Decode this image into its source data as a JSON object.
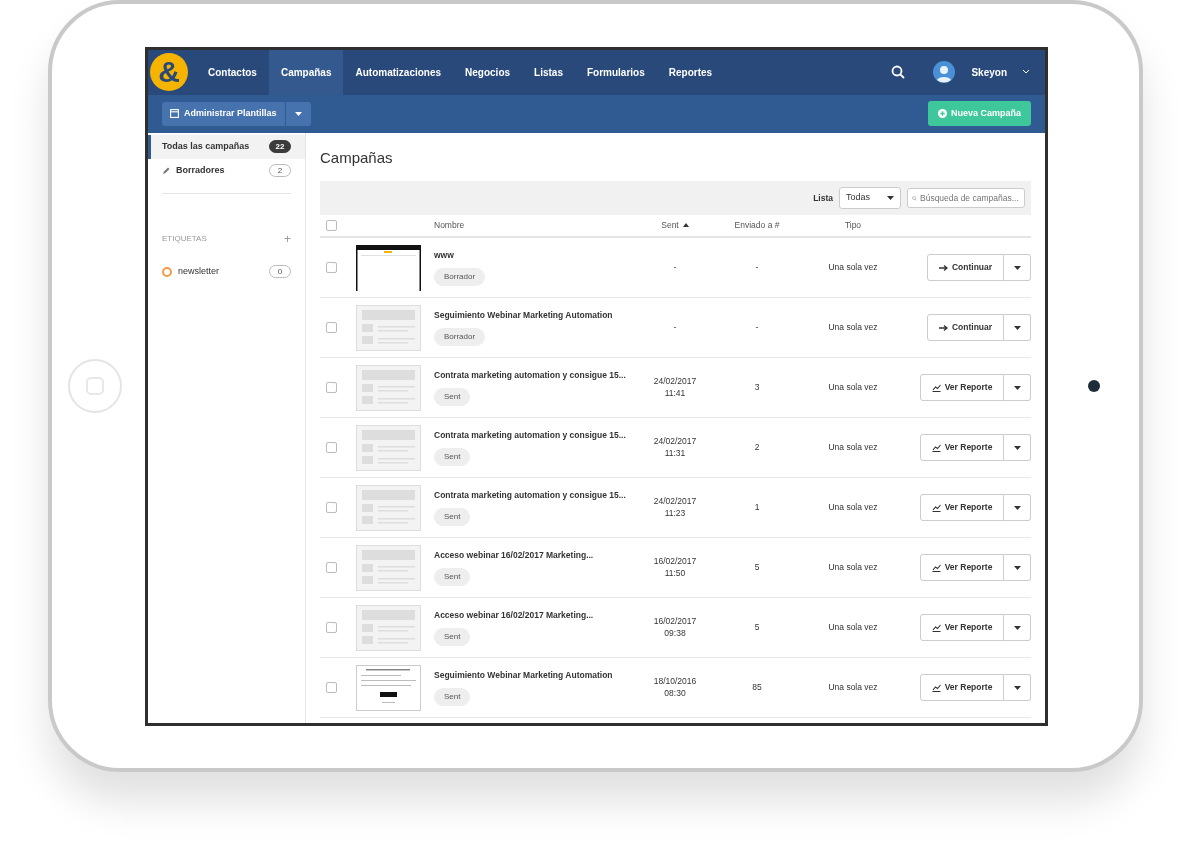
{
  "navbar": {
    "logo": "&",
    "tabs": [
      {
        "label": "Contactos",
        "selected": false
      },
      {
        "label": "Campañas",
        "selected": true
      },
      {
        "label": "Automatizaciones",
        "selected": false
      },
      {
        "label": "Negocios",
        "selected": false
      },
      {
        "label": "Listas",
        "selected": false
      },
      {
        "label": "Formularios",
        "selected": false
      },
      {
        "label": "Reportes",
        "selected": false
      }
    ],
    "user": "Skeyon"
  },
  "subbar": {
    "manage_button": "Administrar Plantillas",
    "new_button": "Nueva Campaña"
  },
  "sidebar": {
    "items": [
      {
        "label": "Todas las campañas",
        "count": "22",
        "selected": true,
        "kind": "all"
      },
      {
        "label": "Borradores",
        "count": "2",
        "selected": false,
        "kind": "drafts"
      }
    ],
    "tags_heading": "ETIQUETAS",
    "add": "+",
    "tags": [
      {
        "label": "newsletter",
        "count": "0",
        "color": "#f39a4a"
      }
    ]
  },
  "main": {
    "title": "Campañas",
    "filter_label": "Lista",
    "filter_value": "Todas",
    "search": {
      "placeholder": "Búsqueda de campañas..."
    },
    "select_all": {
      "checked": false
    },
    "columns": [
      {
        "label": "Nombre"
      },
      {
        "label": "Sent",
        "sort_ascending": true
      },
      {
        "label": "Enviado a #"
      },
      {
        "label": "Tipo"
      }
    ],
    "rows": [
      {
        "preview": {
          "kind": "screenshot"
        },
        "name": "www",
        "status": "Borrador",
        "sent": [],
        "recipients": "-",
        "sent_dash": "-",
        "type": "Una sola vez",
        "action": {
          "kind": "continue",
          "label": "Continuar"
        },
        "checked": false
      },
      {
        "preview": {
          "kind": "placeholder"
        },
        "name": "Seguimiento Webinar Marketing Automation",
        "status": "Borrador",
        "sent": [],
        "recipients": "-",
        "sent_dash": "-",
        "type": "Una sola vez",
        "action": {
          "kind": "continue",
          "label": "Continuar"
        },
        "checked": false
      },
      {
        "preview": {
          "kind": "placeholder"
        },
        "name": "Contrata marketing automation y consigue 15...",
        "status": "Sent",
        "sent": [
          "24/02/2017",
          "11:41"
        ],
        "recipients": "3",
        "type": "Una sola vez",
        "action": {
          "kind": "report",
          "label": "Ver Reporte"
        },
        "checked": false
      },
      {
        "preview": {
          "kind": "placeholder"
        },
        "name": "Contrata marketing automation y consigue 15...",
        "status": "Sent",
        "sent": [
          "24/02/2017",
          "11:31"
        ],
        "recipients": "2",
        "type": "Una sola vez",
        "action": {
          "kind": "report",
          "label": "Ver Reporte"
        },
        "checked": false
      },
      {
        "preview": {
          "kind": "placeholder"
        },
        "name": "Contrata marketing automation y consigue 15...",
        "status": "Sent",
        "sent": [
          "24/02/2017",
          "11:23"
        ],
        "recipients": "1",
        "type": "Una sola vez",
        "action": {
          "kind": "report",
          "label": "Ver Reporte"
        },
        "checked": false
      },
      {
        "preview": {
          "kind": "placeholder"
        },
        "name": "Acceso webinar 16/02/2017 Marketing...",
        "status": "Sent",
        "sent": [
          "16/02/2017",
          "11:50"
        ],
        "recipients": "5",
        "type": "Una sola vez",
        "action": {
          "kind": "report",
          "label": "Ver Reporte"
        },
        "checked": false
      },
      {
        "preview": {
          "kind": "placeholder"
        },
        "name": "Acceso webinar 16/02/2017 Marketing...",
        "status": "Sent",
        "sent": [
          "16/02/2017",
          "09:38"
        ],
        "recipients": "5",
        "type": "Una sola vez",
        "action": {
          "kind": "report",
          "label": "Ver Reporte"
        },
        "checked": false
      },
      {
        "preview": {
          "kind": "document"
        },
        "name": "Seguimiento Webinar Marketing Automation",
        "status": "Sent",
        "sent": [
          "18/10/2016",
          "08:30"
        ],
        "recipients": "85",
        "type": "Una sola vez",
        "action": {
          "kind": "report",
          "label": "Ver Reporte"
        },
        "checked": false
      }
    ]
  }
}
